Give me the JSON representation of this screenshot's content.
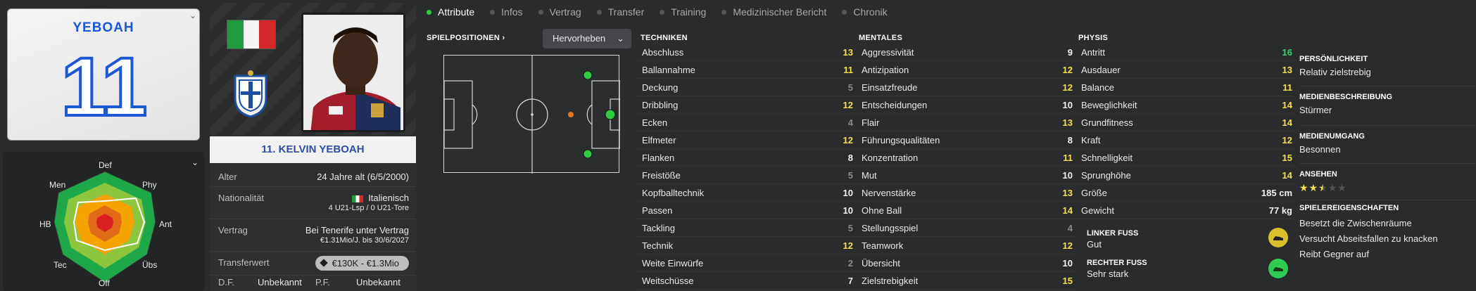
{
  "kit": {
    "name": "YEBOAH",
    "number": "11"
  },
  "radar": {
    "labels": {
      "def": "Def",
      "phy": "Phy",
      "ant": "Ant",
      "ubs": "Übs",
      "off": "Off",
      "tec": "Tec",
      "hb": "HB",
      "men": "Men"
    }
  },
  "player": {
    "name_bar": "11. KELVIN YEBOAH",
    "rows": {
      "alter": {
        "label": "Alter",
        "value": "24 Jahre alt (6/5/2000)"
      },
      "nationalitat": {
        "label": "Nationalität",
        "value": "Italienisch",
        "sub": "4 U21-Lsp / 0 U21-Tore"
      },
      "vertrag": {
        "label": "Vertrag",
        "value": "Bei Tenerife unter Vertrag",
        "sub": "€1.31Mio/J. bis 30/6/2027"
      },
      "transferwert": {
        "label": "Transferwert",
        "value": "€130K - €1.3Mio"
      }
    },
    "df_label": "D.F.",
    "df_value": "Unbekannt",
    "pf_label": "P.F.",
    "pf_value": "Unbekannt"
  },
  "tabs": [
    "Attribute",
    "Infos",
    "Vertrag",
    "Transfer",
    "Training",
    "Medizinischer Bericht",
    "Chronik"
  ],
  "positions": {
    "title": "SPIELPOSITIONEN",
    "highlight": "Hervorheben"
  },
  "sections": {
    "technik": "TECHNIKEN",
    "mental": "MENTALES",
    "physis": "PHYSIS"
  },
  "techniken": [
    {
      "name": "Abschluss",
      "value": "13",
      "color": "yellow"
    },
    {
      "name": "Ballannahme",
      "value": "11",
      "color": "yellow"
    },
    {
      "name": "Deckung",
      "value": "5",
      "color": "grey"
    },
    {
      "name": "Dribbling",
      "value": "12",
      "color": "yellow"
    },
    {
      "name": "Ecken",
      "value": "4",
      "color": "grey"
    },
    {
      "name": "Elfmeter",
      "value": "12",
      "color": "yellow"
    },
    {
      "name": "Flanken",
      "value": "8",
      "color": "white"
    },
    {
      "name": "Freistöße",
      "value": "5",
      "color": "grey"
    },
    {
      "name": "Kopfballtechnik",
      "value": "10",
      "color": "white"
    },
    {
      "name": "Passen",
      "value": "10",
      "color": "white"
    },
    {
      "name": "Tackling",
      "value": "5",
      "color": "grey"
    },
    {
      "name": "Technik",
      "value": "12",
      "color": "yellow"
    },
    {
      "name": "Weite Einwürfe",
      "value": "2",
      "color": "grey"
    },
    {
      "name": "Weitschüsse",
      "value": "7",
      "color": "white"
    }
  ],
  "mentales": [
    {
      "name": "Aggressivität",
      "value": "9",
      "color": "white"
    },
    {
      "name": "Antizipation",
      "value": "12",
      "color": "yellow"
    },
    {
      "name": "Einsatzfreude",
      "value": "12",
      "color": "yellow"
    },
    {
      "name": "Entscheidungen",
      "value": "10",
      "color": "white"
    },
    {
      "name": "Flair",
      "value": "13",
      "color": "yellow"
    },
    {
      "name": "Führungsqualitäten",
      "value": "8",
      "color": "white"
    },
    {
      "name": "Konzentration",
      "value": "11",
      "color": "yellow"
    },
    {
      "name": "Mut",
      "value": "10",
      "color": "white"
    },
    {
      "name": "Nervenstärke",
      "value": "13",
      "color": "yellow"
    },
    {
      "name": "Ohne Ball",
      "value": "14",
      "color": "yellow"
    },
    {
      "name": "Stellungsspiel",
      "value": "4",
      "color": "grey"
    },
    {
      "name": "Teamwork",
      "value": "12",
      "color": "yellow"
    },
    {
      "name": "Übersicht",
      "value": "10",
      "color": "white"
    },
    {
      "name": "Zielstrebigkeit",
      "value": "15",
      "color": "yellow"
    }
  ],
  "physis": [
    {
      "name": "Antritt",
      "value": "16",
      "color": "green"
    },
    {
      "name": "Ausdauer",
      "value": "13",
      "color": "yellow"
    },
    {
      "name": "Balance",
      "value": "11",
      "color": "yellow"
    },
    {
      "name": "Beweglichkeit",
      "value": "14",
      "color": "yellow"
    },
    {
      "name": "Grundfitness",
      "value": "14",
      "color": "yellow"
    },
    {
      "name": "Kraft",
      "value": "12",
      "color": "yellow"
    },
    {
      "name": "Schnelligkeit",
      "value": "15",
      "color": "yellow"
    },
    {
      "name": "Sprunghöhe",
      "value": "14",
      "color": "yellow"
    },
    {
      "name": "Größe",
      "value": "185 cm",
      "color": "white"
    },
    {
      "name": "Gewicht",
      "value": "77 kg",
      "color": "white"
    }
  ],
  "feet": {
    "left_label": "LINKER FUSS",
    "left_value": "Gut",
    "right_label": "RECHTER FUSS",
    "right_value": "Sehr stark"
  },
  "personality": {
    "pers_h": "PERSÖNLICHKEIT",
    "pers_t": "Relativ zielstrebig",
    "medbes_h": "MEDIENBESCHREIBUNG",
    "medbes_t": "Stürmer",
    "medum_h": "MEDIENUMGANG",
    "medum_t": "Besonnen",
    "ansehen_h": "ANSEHEN",
    "ansehen_stars": 2.5,
    "traits_h": "SPIELEREIGENSCHAFTEN",
    "traits": [
      "Besetzt die Zwischenräume",
      "Versucht Abseitsfallen zu knacken",
      "Reibt Gegner auf"
    ]
  },
  "colors": {
    "yellow": "#f4e04d",
    "green": "#39d36b",
    "grey": "#8a8a8a",
    "white": "#f2f2f2"
  }
}
